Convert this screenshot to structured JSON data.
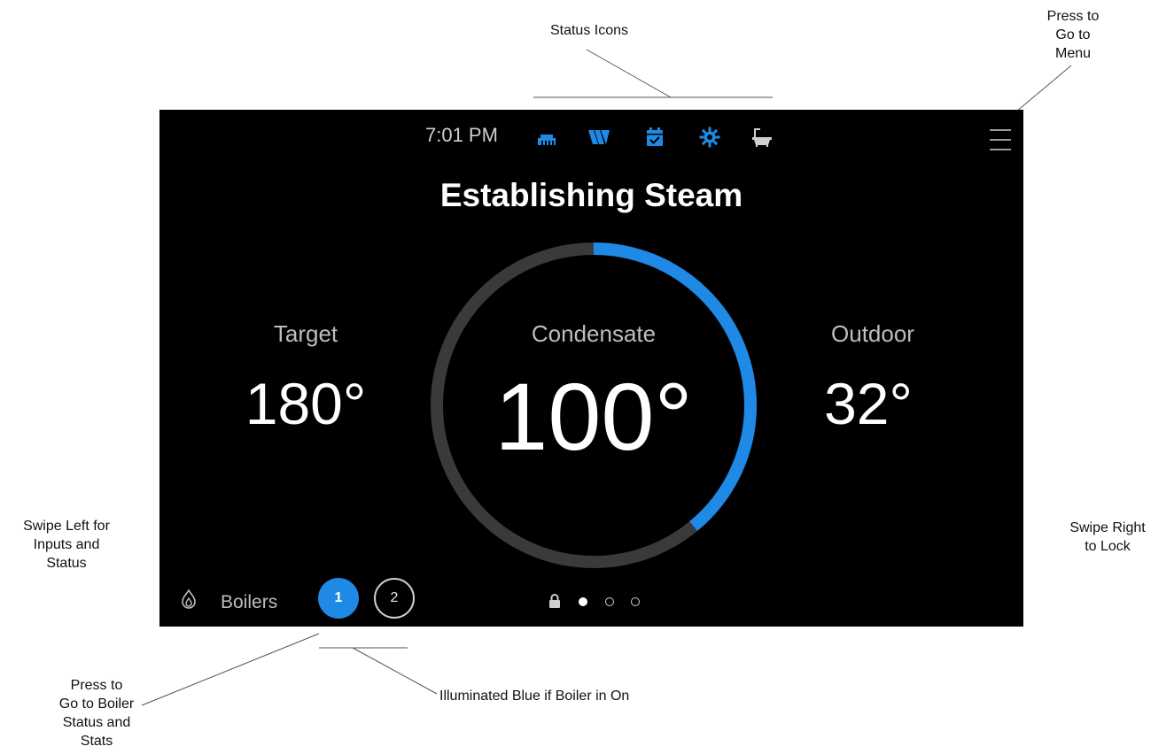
{
  "annotations": {
    "status_icons": "Status Icons",
    "menu": "Press to\nGo to\nMenu",
    "swipe_left": "Swipe Left for\nInputs and\nStatus",
    "swipe_right": "Swipe Right\nto Lock",
    "boiler_press": "Press to\nGo to Boiler\nStatus and\nStats",
    "illuminated": "Illuminated Blue if Boiler in On"
  },
  "screen": {
    "time": "7:01 PM",
    "mode_title": "Establishing Steam",
    "target": {
      "label": "Target",
      "value": "180°"
    },
    "condensate": {
      "label": "Condensate",
      "value": "100°"
    },
    "outdoor": {
      "label": "Outdoor",
      "value": "32°"
    },
    "boilers_label": "Boilers",
    "boilers": [
      {
        "number": "1",
        "state": "on"
      },
      {
        "number": "2",
        "state": "off"
      }
    ],
    "page_dots": [
      "lock",
      "active",
      "inactive",
      "inactive"
    ],
    "dial_progress_fraction": 0.39,
    "status_icons": [
      "network-icon",
      "w-logo-icon",
      "calendar-check-icon",
      "sun-gear-icon",
      "bath-icon"
    ]
  },
  "colors": {
    "accent": "#1e8ae6",
    "screen_bg": "#000000",
    "track": "#3a3a3a"
  }
}
